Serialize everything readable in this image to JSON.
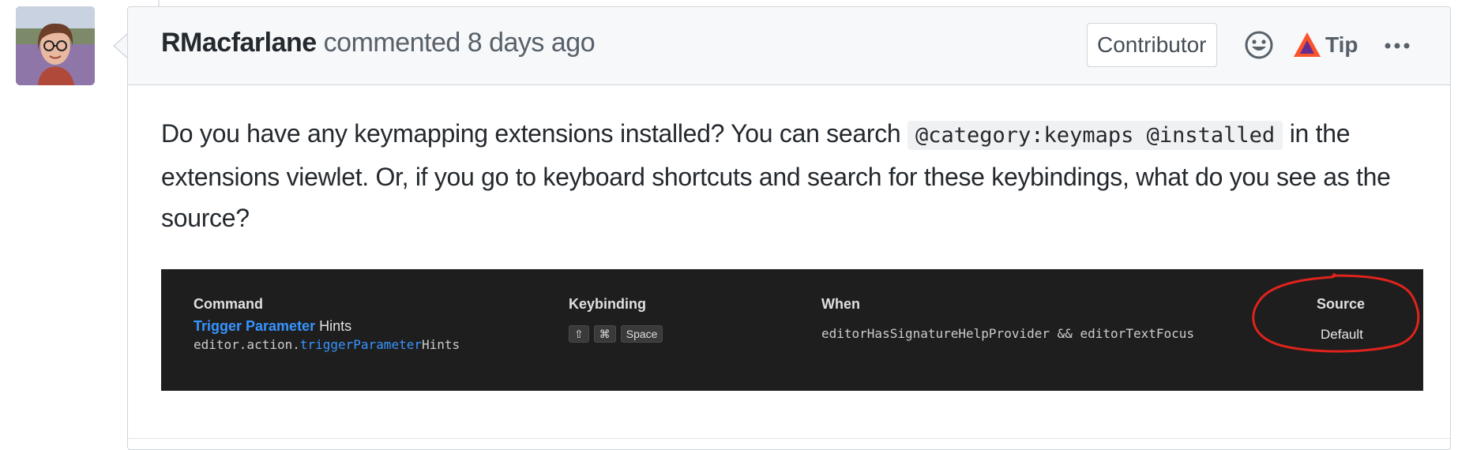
{
  "comment": {
    "author": "RMacfarlane",
    "action": "commented",
    "time": "8 days ago",
    "badge": "Contributor",
    "tip_label": "Tip",
    "icons": [
      "smiley-icon",
      "brave-tip-icon",
      "kebab-horizontal-icon"
    ],
    "body": {
      "text_before_code": "Do you have any keymapping extensions installed? You can search ",
      "code": "@category:keymaps @installed",
      "text_after_code": " in the extensions viewlet. Or, if you go to keyboard shortcuts and search for these keybindings, what do you see as the source?"
    }
  },
  "embedded_screenshot": {
    "headers": {
      "command": "Command",
      "keybinding": "Keybinding",
      "when": "When",
      "source": "Source"
    },
    "row": {
      "command_highlight": "Trigger Parameter",
      "command_rest": " Hints",
      "command_id_prefix": "editor.action.",
      "command_id_highlight": "triggerParameter",
      "command_id_suffix": "Hints",
      "keys": [
        "⇧",
        "⌘",
        "Space"
      ],
      "when": "editorHasSignatureHelpProvider && editorTextFocus",
      "source": "Default"
    },
    "annotation_color": "#e0231c"
  },
  "colors": {
    "header_bg": "#f6f8fa",
    "border": "#d1d5da",
    "screenshot_bg": "#1e1e1e",
    "highlight_blue": "#3794ff",
    "brave_orange": "#fb542b",
    "brave_purple": "#662d91"
  }
}
